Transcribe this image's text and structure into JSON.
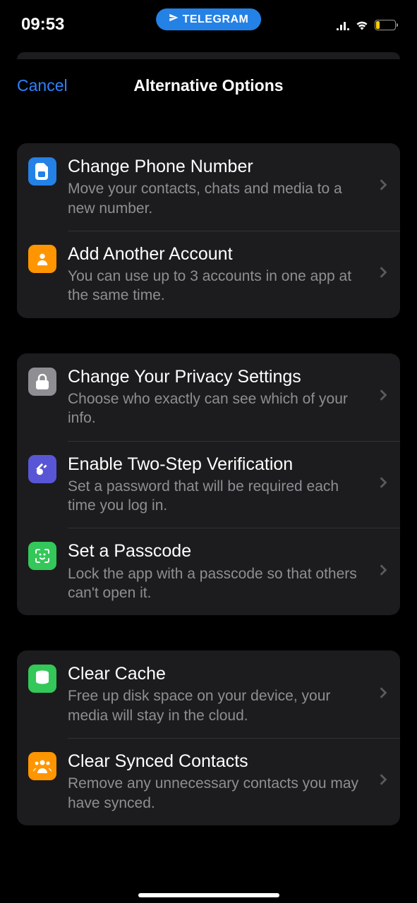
{
  "status": {
    "time": "09:53",
    "pill": "TELEGRAM"
  },
  "nav": {
    "cancel": "Cancel",
    "title": "Alternative Options"
  },
  "sections": [
    {
      "rows": [
        {
          "title": "Change Phone Number",
          "subtitle": "Move your contacts, chats and media to a new number."
        },
        {
          "title": "Add Another Account",
          "subtitle": "You can use up to 3 accounts in one app at the same time."
        }
      ]
    },
    {
      "rows": [
        {
          "title": "Change Your Privacy Settings",
          "subtitle": "Choose who exactly can see which of your info."
        },
        {
          "title": "Enable Two-Step Verification",
          "subtitle": "Set a password that will be required each time you log in."
        },
        {
          "title": "Set a Passcode",
          "subtitle": "Lock the app with a passcode so that others can't open it."
        }
      ]
    },
    {
      "rows": [
        {
          "title": "Clear Cache",
          "subtitle": "Free up disk space on your device, your media will stay in the cloud."
        },
        {
          "title": "Clear Synced Contacts",
          "subtitle": "Remove any unnecessary contacts you may have synced."
        }
      ]
    }
  ]
}
